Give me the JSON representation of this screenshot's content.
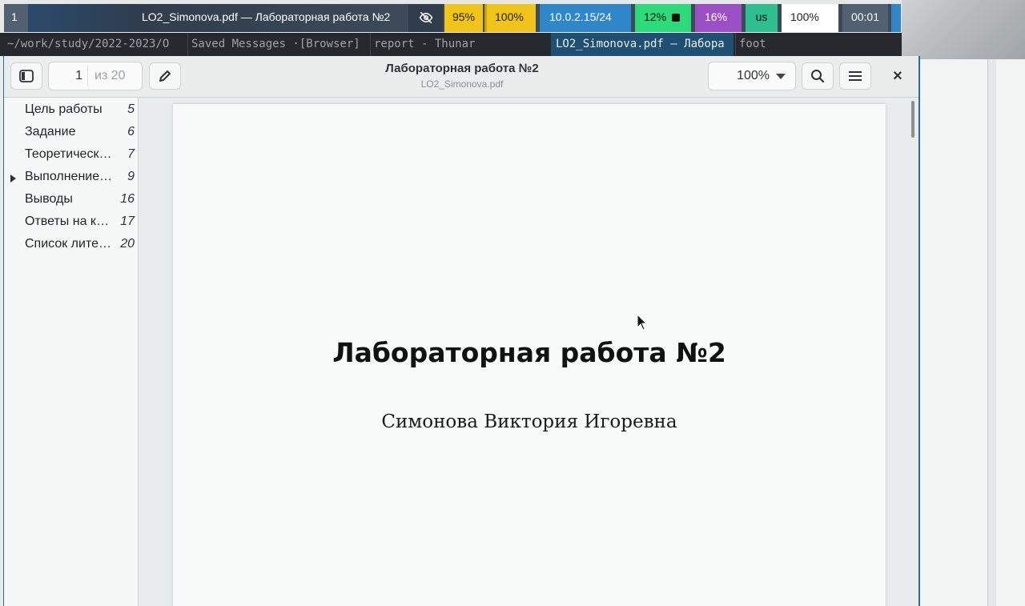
{
  "statusbar": {
    "workspace": "1",
    "window_title": "LO2_Simonova.pdf — Лабораторная работа №2",
    "hidden_icon": "eye-off-icon",
    "disk": "95%",
    "volume": "100%",
    "network": "10.0.2.15/24",
    "cpu": "12%",
    "memory": "16%",
    "keyboard_layout": "us",
    "battery": "100%",
    "clock": "00:01"
  },
  "tabs": [
    {
      "label": "~/work/study/2022-2023/O"
    },
    {
      "label": "Saved Messages ·[Browser]"
    },
    {
      "label": "report - Thunar"
    },
    {
      "label": "LO2_Simonova.pdf — Лабора"
    },
    {
      "label": "foot"
    }
  ],
  "header": {
    "current_page": "1",
    "page_total": "из 20",
    "title": "Лабораторная работа №2",
    "subtitle": "LO2_Simonova.pdf",
    "zoom": "100%"
  },
  "outline": [
    {
      "label": "Цель работы",
      "page": "5"
    },
    {
      "label": "Задание",
      "page": "6"
    },
    {
      "label": "Теоретические сведения",
      "page": "7"
    },
    {
      "label": "Выполнение лабораторной работы",
      "page": "9",
      "expandable": true
    },
    {
      "label": "Выводы",
      "page": "16"
    },
    {
      "label": "Ответы на контрольные вопросы",
      "page": "17"
    },
    {
      "label": "Список литературы",
      "page": "20"
    }
  ],
  "document": {
    "title": "Лабораторная работа №2",
    "author": "Симонова Виктория Игоревна"
  }
}
